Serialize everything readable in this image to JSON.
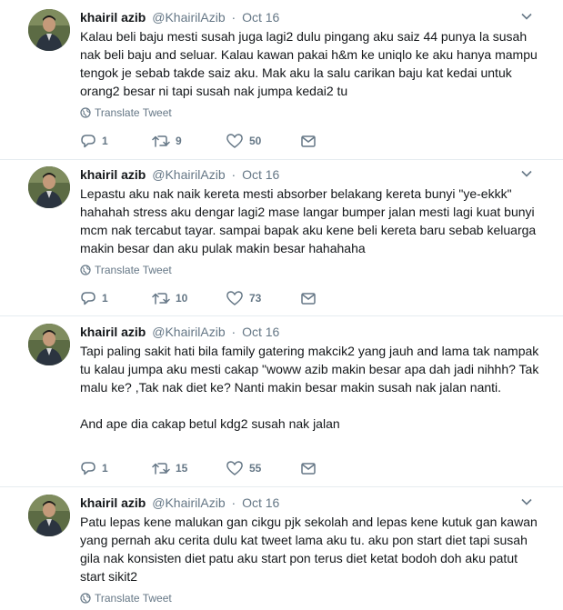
{
  "tweets": [
    {
      "name": "khairil azib",
      "handle": "@KhairilAzib",
      "separator": "·",
      "date": "Oct 16",
      "text": "Kalau beli baju mesti susah juga lagi2 dulu pingang aku saiz 44 punya la susah nak beli baju and seluar. Kalau kawan pakai h&m ke uniqlo ke aku hanya mampu tengok je sebab takde saiz aku. Mak aku la salu carikan baju kat kedai untuk orang2 besar ni tapi susah nak jumpa kedai2 tu",
      "translate": "Translate Tweet",
      "replies": "1",
      "retweets": "9",
      "likes": "50"
    },
    {
      "name": "khairil azib",
      "handle": "@KhairilAzib",
      "separator": "·",
      "date": "Oct 16",
      "text": "Lepastu aku nak naik kereta mesti absorber belakang kereta bunyi \"ye-ekkk\" hahahah stress aku dengar lagi2 mase langar bumper jalan mesti lagi kuat bunyi mcm nak tercabut tayar. sampai bapak aku kene beli kereta baru sebab keluarga makin besar dan aku pulak makin besar hahahaha",
      "translate": "Translate Tweet",
      "replies": "1",
      "retweets": "10",
      "likes": "73"
    },
    {
      "name": "khairil azib",
      "handle": "@KhairilAzib",
      "separator": "·",
      "date": "Oct 16",
      "text": "Tapi paling sakit hati bila family gatering makcik2 yang jauh and lama tak nampak tu kalau jumpa aku mesti cakap \"woww azib makin besar apa dah jadi nihhh? Tak malu ke? ,Tak nak diet ke? Nanti makin besar makin susah nak jalan nanti.\n\nAnd ape dia cakap betul kdg2 susah nak jalan",
      "translate": "",
      "replies": "1",
      "retweets": "15",
      "likes": "55"
    },
    {
      "name": "khairil azib",
      "handle": "@KhairilAzib",
      "separator": "·",
      "date": "Oct 16",
      "text": "Patu lepas kene malukan gan cikgu pjk sekolah and lepas kene kutuk gan kawan yang pernah aku cerita dulu kat tweet lama aku tu. aku pon start diet tapi susah gila nak konsisten diet patu aku start pon terus diet ketat bodoh doh aku patut start sikit2",
      "translate": "Translate Tweet",
      "replies": "",
      "retweets": "",
      "likes": ""
    }
  ],
  "icons": {
    "globe": "globe-icon",
    "reply": "reply-icon",
    "retweet": "retweet-icon",
    "like": "heart-icon",
    "dm": "envelope-icon",
    "more": "chevron-down-icon"
  },
  "colors": {
    "text": "#14171a",
    "muted": "#657786",
    "divider": "#e6ecf0"
  }
}
